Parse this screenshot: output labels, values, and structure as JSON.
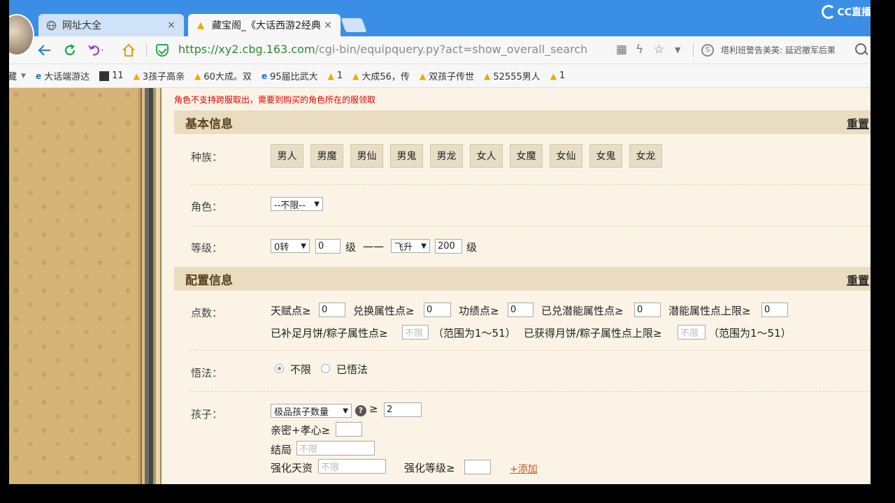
{
  "tabs": [
    {
      "title": "网址大全",
      "close": "×"
    },
    {
      "title": "藏宝阁_《大话西游2经典",
      "close": "×"
    }
  ],
  "overlay": {
    "logo_text": "CC直播"
  },
  "address": {
    "host": "https://xy2.cbg.163.com",
    "path": "/cgi-bin/equipquery.py?act=show_overall_search",
    "search_text": "塔利班警告美英: 延迟撤军后果"
  },
  "bookmarks": [
    "藏",
    "大话端游达",
    "11",
    "3孩子高亲",
    "60大成。双",
    "95届比武大",
    "1",
    "大成56，传",
    "双孩子传世",
    "52555男人",
    "1"
  ],
  "page": {
    "notice": "角色不支持跨服取出，需要到购买的角色所在的服领取",
    "basic": {
      "title": "基本信息",
      "reset": "重置",
      "race_label": "种族：",
      "races": [
        "男人",
        "男魔",
        "男仙",
        "男鬼",
        "男龙",
        "女人",
        "女魔",
        "女仙",
        "女鬼",
        "女龙"
      ],
      "role_label": "角色：",
      "role_select": "--不限--",
      "level_label": "等级：",
      "level_from_select": "0转",
      "level_from_value": "0",
      "level_unit": "级",
      "level_sep": "一一",
      "level_to_select": "飞升",
      "level_to_value": "200",
      "level_unit2": "级"
    },
    "config": {
      "title": "配置信息",
      "reset": "重置",
      "points_label": "点数：",
      "p1": "天赋点≥",
      "p1_val": "0",
      "p2": "兑换属性点≥",
      "p2_val": "0",
      "p3": "功绩点≥",
      "p3_val": "0",
      "p4": "已兑潜能属性点≥",
      "p4_val": "0",
      "p5": "潜能属性点上限≥",
      "p5_val": "0",
      "p6": "已补足月饼/粽子属性点≥",
      "p6_placeholder": "不限",
      "p6_range": "（范围为1～51）",
      "p7": "已获得月饼/粽子属性点上限≥",
      "p7_placeholder": "不限",
      "p7_range": "（范围为1～51）",
      "wufa_label": "悟法：",
      "wufa_opt1": "不限",
      "wufa_opt2": "已悟法",
      "child_label": "孩子：",
      "child_select": "极品孩子数量",
      "child_help": "?",
      "child_ge": "≥",
      "child_val": "2",
      "intimacy": "亲密+孝心≥",
      "ending": "结局",
      "ending_placeholder": "不限",
      "talent": "强化天资",
      "talent_placeholder": "不限",
      "strength_level": "强化等级≥",
      "add": "+添加"
    }
  }
}
